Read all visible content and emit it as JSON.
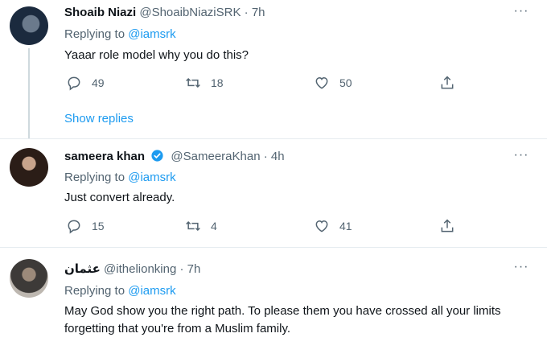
{
  "tweets": [
    {
      "name": "Shoaib Niazi",
      "handle": "@ShoaibNiaziSRK",
      "dot": "·",
      "time": "7h",
      "replying_prefix": "Replying to",
      "replying_to": "@iamsrk",
      "text": "Yaaar role model why you do this?",
      "replies": "49",
      "retweets": "18",
      "likes": "50",
      "verified": false,
      "avatar": "user-avatar",
      "show_replies": "Show replies"
    },
    {
      "name": "sameera khan",
      "handle": "@SameeraKhan",
      "dot": "·",
      "time": "4h",
      "replying_prefix": "Replying to",
      "replying_to": "@iamsrk",
      "text": "Just convert already.",
      "replies": "15",
      "retweets": "4",
      "likes": "41",
      "verified": true,
      "avatar": "user-avatar"
    },
    {
      "name": "عثمان",
      "handle": "@ithelionking",
      "dot": "·",
      "time": "7h",
      "replying_prefix": "Replying to",
      "replying_to": "@iamsrk",
      "text": "May God show you the right path. To please them you have crossed all your limits forgetting that you're from a Muslim family.",
      "verified": false,
      "avatar": "user-avatar"
    }
  ],
  "icons": {
    "more": "more-options-icon",
    "reply": "reply-icon",
    "retweet": "retweet-icon",
    "like": "heart-icon",
    "share": "share-icon",
    "verified": "verified-badge-icon"
  },
  "colors": {
    "link": "#1d9bf0",
    "secondary_text": "#536471",
    "primary_text": "#0f1419",
    "divider": "#e6ecf0"
  }
}
